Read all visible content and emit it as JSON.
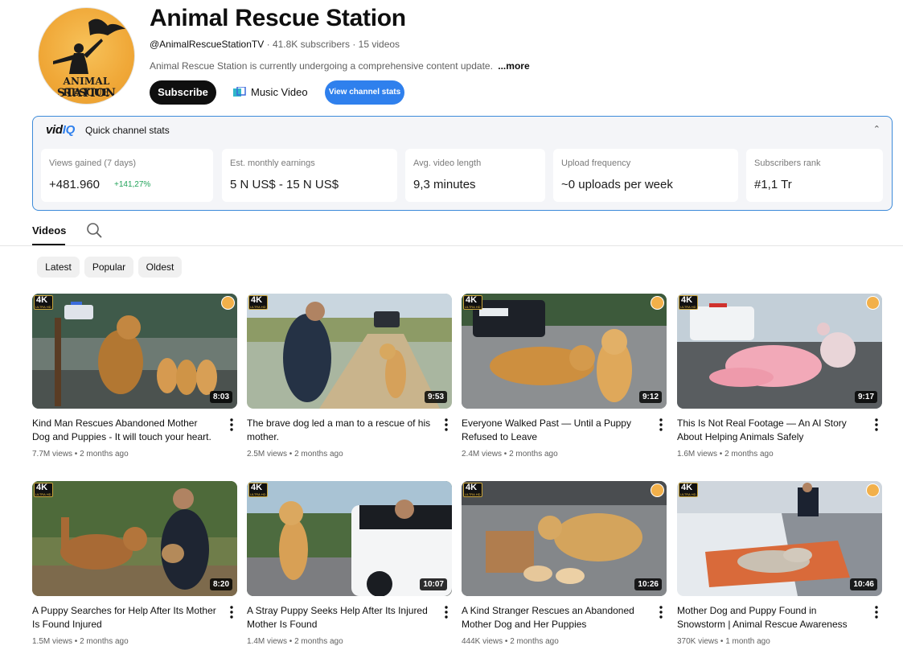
{
  "channel": {
    "logo_line1": "ANIMAL RESCUE",
    "logo_line2": "STATION",
    "title": "Animal Rescue Station",
    "handle": "@AnimalRescueStationTV",
    "subscribers": "41.8K subscribers",
    "videos_count": "15 videos",
    "description": "Animal Rescue Station is currently undergoing a comprehensive content update.",
    "more_label": "...more",
    "subscribe_label": "Subscribe",
    "music_label": "Music Video",
    "view_stats_label": "View channel stats"
  },
  "vidiq": {
    "logo_main": "vid",
    "logo_iq": "IQ",
    "title": "Quick channel stats",
    "stats": [
      {
        "label": "Views gained (7 days)",
        "value": "+481.960",
        "change": "+141,27%"
      },
      {
        "label": "Est. monthly earnings",
        "value": "5 N US$ - 15 N US$"
      },
      {
        "label": "Avg. video length",
        "value": "9,3 minutes"
      },
      {
        "label": "Upload frequency",
        "value": "~0 uploads per week"
      },
      {
        "label": "Subscribers rank",
        "value": "#1,1 Tr"
      }
    ]
  },
  "tabs": {
    "videos": "Videos"
  },
  "filters": [
    "Latest",
    "Popular",
    "Oldest"
  ],
  "badge": {
    "k": "4K",
    "u": "ULTRA HD"
  },
  "videos": [
    {
      "title": "Kind Man Rescues Abandoned Mother Dog and Puppies - It will touch your heart.",
      "views": "7.7M views",
      "age": "2 months ago",
      "duration": "8:03"
    },
    {
      "title": "The brave dog led a man to a rescue of his mother.",
      "views": "2.5M views",
      "age": "2 months ago",
      "duration": "9:53"
    },
    {
      "title": "Everyone Walked Past — Until a Puppy Refused to Leave",
      "views": "2.4M views",
      "age": "2 months ago",
      "duration": "9:12"
    },
    {
      "title": "This Is Not Real Footage — An AI Story About Helping Animals Safely",
      "views": "1.6M views",
      "age": "2 months ago",
      "duration": "9:17"
    },
    {
      "title": "A Puppy Searches for Help After Its Mother Is Found Injured",
      "views": "1.5M views",
      "age": "2 months ago",
      "duration": "8:20"
    },
    {
      "title": "A Stray Puppy Seeks Help After Its Injured Mother Is Found",
      "views": "1.4M views",
      "age": "2 months ago",
      "duration": "10:07"
    },
    {
      "title": "A Kind Stranger Rescues an Abandoned Mother Dog and Her Puppies",
      "views": "444K views",
      "age": "2 months ago",
      "duration": "10:26"
    },
    {
      "title": "Mother Dog and Puppy Found in Snowstorm | Animal Rescue Awareness",
      "views": "370K views",
      "age": "1 month ago",
      "duration": "10:46"
    }
  ]
}
